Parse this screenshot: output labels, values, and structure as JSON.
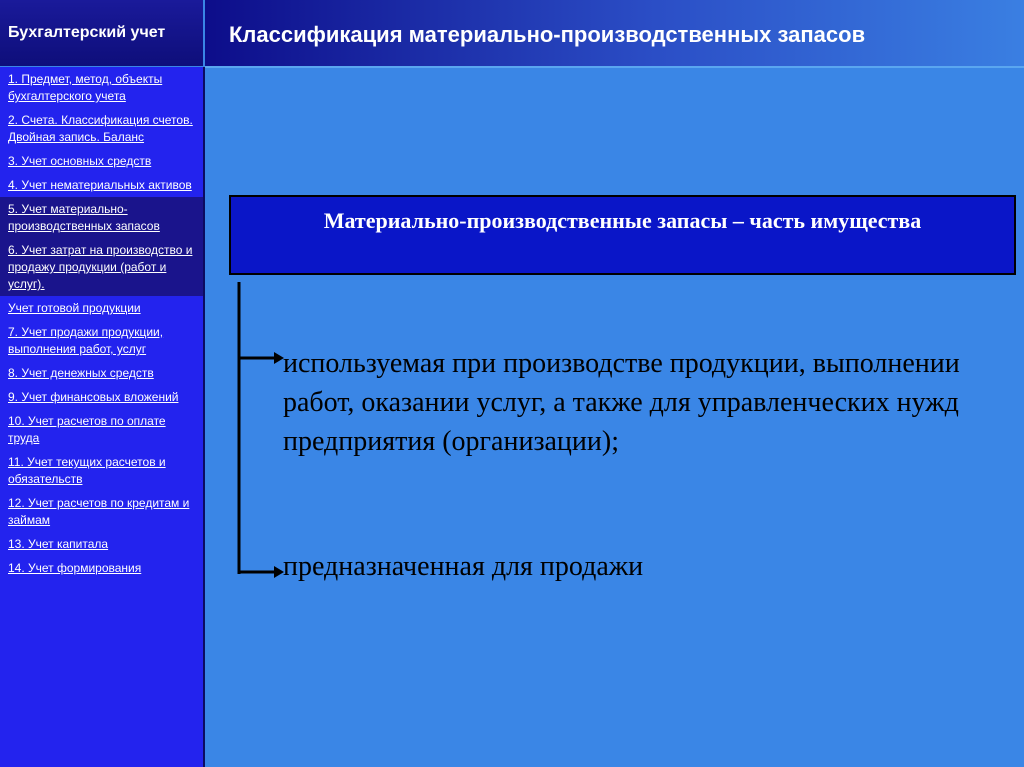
{
  "sidebar": {
    "title": "Бухгалтерский учет",
    "items": [
      {
        "label": "1. Предмет, метод, объекты бухгалтерского учета"
      },
      {
        "label": " 2. Счета. Классификация счетов. Двойная запись. Баланс"
      },
      {
        "label": " 3. Учет основных средств"
      },
      {
        "label": " 4. Учет нематериальных активов"
      },
      {
        "label": " 5. Учет материально-производственных запасов"
      },
      {
        "label": " 6. Учет затрат на производство и продажу продукции (работ и услуг)."
      },
      {
        "label": " Учет готовой продукции"
      },
      {
        "label": " 7. Учет продажи продукции, выполнения работ, услуг"
      },
      {
        "label": " 8. Учет денежных средств"
      },
      {
        "label": " 9. Учет финансовых вложений"
      },
      {
        "label": "10. Учет расчетов по оплате труда"
      },
      {
        "label": "11. Учет текущих расчетов и обязательств"
      },
      {
        "label": "12. Учет расчетов по кредитам и займам"
      },
      {
        "label": "13. Учет капитала"
      },
      {
        "label": "14. Учет формирования"
      }
    ]
  },
  "header": {
    "title": "Классификация материально-производственных запасов"
  },
  "main": {
    "heading": "Материально-производственные запасы – часть имущества",
    "items": [
      "используемая при производстве продукции, выполнении работ, оказании услуг, а также для управленческих нужд предприятия (организации);",
      "предназначенная для продажи"
    ]
  },
  "colors": {
    "background": "#3a86e6",
    "sidebar": "#2323ee",
    "sidebar_active": "#1a148c",
    "heading_box": "#0a16c8"
  }
}
